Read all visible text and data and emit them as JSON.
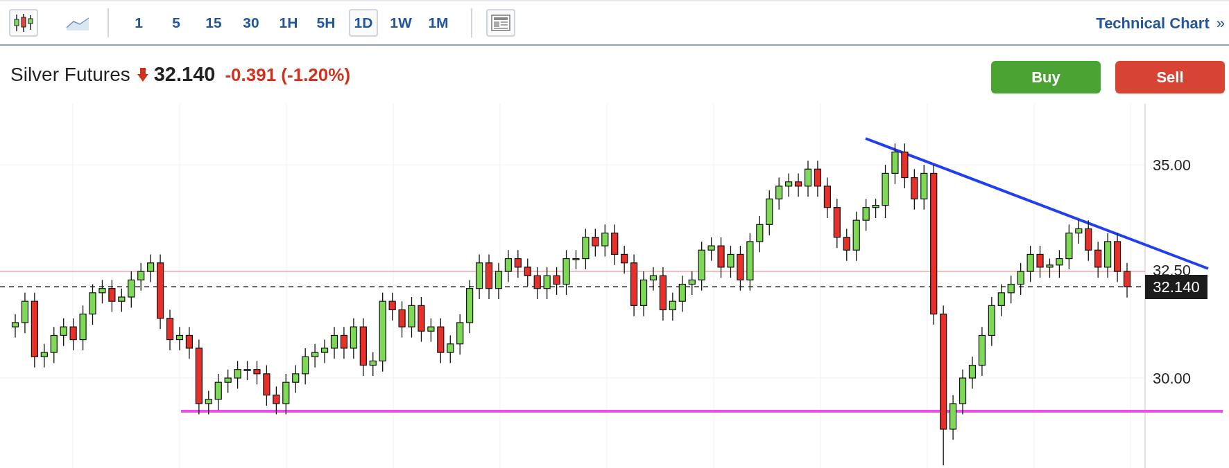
{
  "toolbar": {
    "chart_types": [
      {
        "kind": "candles",
        "selected": true
      },
      {
        "kind": "line",
        "selected": false
      }
    ],
    "intervals": [
      {
        "label": "1",
        "selected": false
      },
      {
        "label": "5",
        "selected": false
      },
      {
        "label": "15",
        "selected": false
      },
      {
        "label": "30",
        "selected": false
      },
      {
        "label": "1H",
        "selected": false
      },
      {
        "label": "5H",
        "selected": false
      },
      {
        "label": "1D",
        "selected": true
      },
      {
        "label": "1W",
        "selected": false
      },
      {
        "label": "1M",
        "selected": false
      }
    ],
    "link": "Technical Chart",
    "link_icon": "»"
  },
  "header": {
    "instrument": "Silver Futures",
    "falling": true,
    "price": "32.140",
    "change": "-0.391 (-1.20%)"
  },
  "buttons": [
    {
      "kind": "buy",
      "label": "Buy"
    },
    {
      "kind": "sell",
      "label": "Sell"
    }
  ],
  "chart": {
    "last_price": "32.140",
    "chart_data": {
      "type": "candlestick",
      "grid": true,
      "ylim": [
        27.89,
        36.43
      ],
      "ref_lines": [
        {
          "axis": "y",
          "value": 29.22,
          "color": "#e84ee8"
        },
        {
          "axis": "y",
          "value": 32.5,
          "color": "#f08070"
        },
        {
          "axis": "y",
          "value": 32.14,
          "color": "#222222"
        }
      ],
      "ohlc": [
        [
          31.2,
          31.5,
          30.95,
          31.3
        ],
        [
          31.3,
          32.0,
          31.05,
          31.8
        ],
        [
          31.8,
          32.0,
          30.25,
          30.5
        ],
        [
          30.5,
          30.8,
          30.25,
          30.6
        ],
        [
          30.6,
          31.2,
          30.35,
          31.0
        ],
        [
          31.0,
          31.4,
          30.75,
          31.2
        ],
        [
          31.2,
          31.4,
          30.65,
          30.9
        ],
        [
          30.9,
          31.7,
          30.65,
          31.5
        ],
        [
          31.5,
          32.2,
          31.25,
          32.0
        ],
        [
          32.0,
          32.3,
          31.75,
          32.1
        ],
        [
          32.1,
          32.3,
          31.55,
          31.8
        ],
        [
          31.8,
          32.1,
          31.55,
          31.9
        ],
        [
          31.9,
          32.5,
          31.65,
          32.3
        ],
        [
          32.3,
          32.7,
          32.05,
          32.5
        ],
        [
          32.5,
          32.9,
          32.25,
          32.7
        ],
        [
          32.7,
          32.9,
          31.15,
          31.4
        ],
        [
          31.4,
          31.6,
          30.65,
          30.9
        ],
        [
          30.9,
          31.2,
          30.65,
          31.0
        ],
        [
          31.0,
          31.2,
          30.45,
          30.7
        ],
        [
          30.7,
          30.9,
          29.15,
          29.4
        ],
        [
          29.4,
          29.7,
          29.15,
          29.5
        ],
        [
          29.5,
          30.1,
          29.25,
          29.9
        ],
        [
          29.9,
          30.2,
          29.65,
          30.0
        ],
        [
          30.0,
          30.4,
          29.75,
          30.2
        ],
        [
          30.2,
          30.4,
          29.95,
          30.2
        ],
        [
          30.2,
          30.4,
          29.85,
          30.1
        ],
        [
          30.1,
          30.3,
          29.35,
          29.6
        ],
        [
          29.6,
          29.8,
          29.15,
          29.4
        ],
        [
          29.4,
          30.1,
          29.15,
          29.9
        ],
        [
          29.9,
          30.3,
          29.65,
          30.1
        ],
        [
          30.1,
          30.7,
          29.85,
          30.5
        ],
        [
          30.5,
          30.8,
          30.25,
          30.6
        ],
        [
          30.6,
          30.9,
          30.35,
          30.7
        ],
        [
          30.7,
          31.2,
          30.45,
          31.0
        ],
        [
          31.0,
          31.2,
          30.45,
          30.7
        ],
        [
          30.7,
          31.4,
          30.45,
          31.2
        ],
        [
          31.2,
          31.4,
          30.05,
          30.3
        ],
        [
          30.3,
          30.6,
          30.05,
          30.4
        ],
        [
          30.4,
          32.0,
          30.15,
          31.8
        ],
        [
          31.8,
          32.0,
          31.35,
          31.6
        ],
        [
          31.6,
          31.8,
          30.95,
          31.2
        ],
        [
          31.2,
          31.9,
          30.95,
          31.7
        ],
        [
          31.7,
          31.9,
          30.85,
          31.1
        ],
        [
          31.1,
          31.4,
          30.85,
          31.2
        ],
        [
          31.2,
          31.4,
          30.35,
          30.6
        ],
        [
          30.6,
          31.0,
          30.35,
          30.8
        ],
        [
          30.8,
          31.5,
          30.55,
          31.3
        ],
        [
          31.3,
          32.3,
          31.05,
          32.1
        ],
        [
          32.1,
          32.9,
          31.85,
          32.7
        ],
        [
          32.7,
          32.9,
          31.85,
          32.1
        ],
        [
          32.1,
          32.7,
          31.85,
          32.5
        ],
        [
          32.5,
          33.0,
          32.25,
          32.8
        ],
        [
          32.8,
          33.0,
          32.35,
          32.6
        ],
        [
          32.6,
          32.8,
          32.15,
          32.4
        ],
        [
          32.4,
          32.6,
          31.85,
          32.1
        ],
        [
          32.1,
          32.6,
          31.85,
          32.4
        ],
        [
          32.4,
          32.6,
          31.95,
          32.2
        ],
        [
          32.2,
          33.0,
          31.95,
          32.8
        ],
        [
          32.8,
          33.0,
          32.55,
          32.8
        ],
        [
          32.8,
          33.5,
          32.55,
          33.3
        ],
        [
          33.3,
          33.5,
          32.85,
          33.1
        ],
        [
          33.1,
          33.6,
          32.85,
          33.4
        ],
        [
          33.4,
          33.6,
          32.65,
          32.9
        ],
        [
          32.9,
          33.1,
          32.45,
          32.7
        ],
        [
          32.7,
          32.9,
          31.45,
          31.7
        ],
        [
          31.7,
          32.5,
          31.45,
          32.3
        ],
        [
          32.3,
          32.6,
          32.05,
          32.4
        ],
        [
          32.4,
          32.6,
          31.35,
          31.6
        ],
        [
          31.6,
          32.0,
          31.35,
          31.8
        ],
        [
          31.8,
          32.4,
          31.55,
          32.2
        ],
        [
          32.2,
          32.5,
          31.95,
          32.3
        ],
        [
          32.3,
          33.2,
          32.05,
          33.0
        ],
        [
          33.0,
          33.3,
          32.75,
          33.1
        ],
        [
          33.1,
          33.3,
          32.35,
          32.6
        ],
        [
          32.6,
          33.1,
          32.35,
          32.9
        ],
        [
          32.9,
          33.1,
          32.05,
          32.3
        ],
        [
          32.3,
          33.4,
          32.05,
          33.2
        ],
        [
          33.2,
          33.8,
          32.95,
          33.6
        ],
        [
          33.6,
          34.4,
          33.35,
          34.2
        ],
        [
          34.2,
          34.7,
          33.95,
          34.5
        ],
        [
          34.5,
          34.8,
          34.25,
          34.6
        ],
        [
          34.6,
          34.8,
          34.25,
          34.5
        ],
        [
          34.5,
          35.1,
          34.25,
          34.9
        ],
        [
          34.9,
          35.1,
          34.25,
          34.5
        ],
        [
          34.5,
          34.7,
          33.75,
          34.0
        ],
        [
          34.0,
          34.2,
          33.05,
          33.3
        ],
        [
          33.3,
          33.5,
          32.75,
          33.0
        ],
        [
          33.0,
          33.9,
          32.75,
          33.7
        ],
        [
          33.7,
          34.2,
          33.45,
          34.0
        ],
        [
          34.0,
          34.2,
          33.75,
          34.05
        ],
        [
          34.05,
          35.0,
          33.75,
          34.8
        ],
        [
          34.8,
          35.5,
          34.55,
          35.3
        ],
        [
          35.3,
          35.5,
          34.45,
          34.7
        ],
        [
          34.7,
          34.9,
          33.95,
          34.2
        ],
        [
          34.2,
          35.0,
          33.95,
          34.8
        ],
        [
          34.8,
          35.0,
          31.25,
          31.5
        ],
        [
          31.5,
          31.7,
          27.95,
          28.8
        ],
        [
          28.8,
          29.6,
          28.55,
          29.4
        ],
        [
          29.4,
          30.2,
          29.15,
          30.0
        ],
        [
          30.0,
          30.5,
          29.75,
          30.3
        ],
        [
          30.3,
          31.2,
          30.05,
          31.0
        ],
        [
          31.0,
          31.9,
          30.75,
          31.7
        ],
        [
          31.7,
          32.2,
          31.45,
          32.0
        ],
        [
          32.0,
          32.4,
          31.75,
          32.2
        ],
        [
          32.2,
          32.7,
          31.95,
          32.5
        ],
        [
          32.5,
          33.1,
          32.25,
          32.9
        ],
        [
          32.9,
          33.1,
          32.35,
          32.6
        ],
        [
          32.6,
          32.8,
          32.35,
          32.65
        ],
        [
          32.65,
          33.0,
          32.35,
          32.8
        ],
        [
          32.8,
          33.6,
          32.55,
          33.4
        ],
        [
          33.4,
          33.7,
          33.15,
          33.5
        ],
        [
          33.5,
          33.7,
          32.75,
          33.0
        ],
        [
          33.0,
          33.2,
          32.35,
          32.6
        ],
        [
          32.6,
          33.4,
          32.35,
          33.2
        ],
        [
          33.2,
          33.4,
          32.25,
          32.5
        ],
        [
          32.5,
          32.7,
          31.89,
          32.14
        ]
      ],
      "yticks": [
        {
          "value": 30,
          "label": "30.00"
        },
        {
          "value": 32.5,
          "label": "32.50"
        },
        {
          "value": 35,
          "label": "35.00"
        }
      ]
    }
  }
}
